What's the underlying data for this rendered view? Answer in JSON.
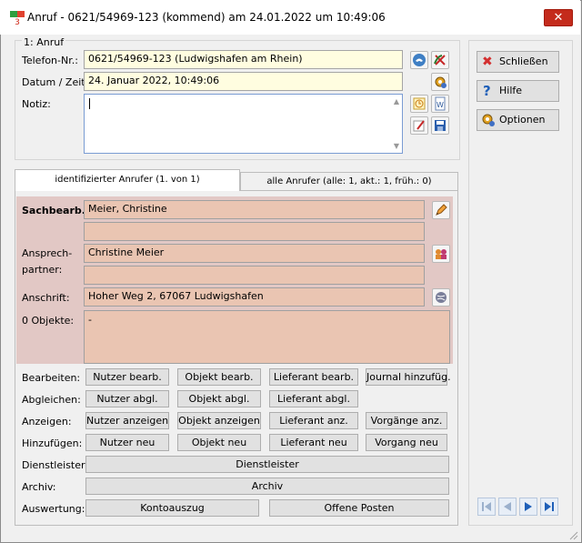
{
  "window": {
    "title": "Anruf - 0621/54969-123 (kommend) am 24.01.2022 um 10:49:06",
    "close_glyph": "✕"
  },
  "call": {
    "group_label": "1: Anruf",
    "phone_label": "Telefon-Nr.:",
    "phone_value": "0621/54969-123  (Ludwigshafen am Rhein)",
    "datetime_label": "Datum / Zeit:",
    "datetime_value": "24. Januar 2022,  10:49:06",
    "note_label": "Notiz:",
    "note_value": ""
  },
  "tabs": [
    {
      "label": "identifizierter Anrufer  (1. von 1)"
    },
    {
      "label": "alle Anrufer (alle: 1,  akt.: 1,  früh.: 0)"
    }
  ],
  "caller": {
    "clerk_label": "Sachbearb.:",
    "clerk_value": "Meier, Christine",
    "clerk_value2": "",
    "contact_label": "Ansprech-partner:",
    "contact_value": "Christine Meier",
    "contact_value2": "",
    "address_label": "Anschrift:",
    "address_value": "Hoher Weg 2, 67067 Ludwigshafen",
    "objects_label": "0 Objekte:",
    "objects_value": "-"
  },
  "actions": [
    {
      "label": "Bearbeiten:",
      "buttons": [
        "Nutzer bearb.",
        "Objekt bearb.",
        "Lieferant bearb.",
        "Journal hinzufüg."
      ]
    },
    {
      "label": "Abgleichen:",
      "buttons": [
        "Nutzer abgl.",
        "Objekt abgl.",
        "Lieferant abgl."
      ]
    },
    {
      "label": "Anzeigen:",
      "buttons": [
        "Nutzer anzeigen",
        "Objekt anzeigen",
        "Lieferant anz.",
        "Vorgänge anz."
      ]
    },
    {
      "label": "Hinzufügen:",
      "buttons": [
        "Nutzer neu",
        "Objekt neu",
        "Lieferant neu",
        "Vorgang neu"
      ]
    },
    {
      "label": "Dienstleister:",
      "buttons": [
        "Dienstleister"
      ]
    },
    {
      "label": "Archiv:",
      "buttons": [
        "Archiv"
      ]
    },
    {
      "label": "Auswertung:",
      "buttons": [
        "Kontoauszug",
        "Offene Posten"
      ]
    }
  ],
  "sidebar": {
    "close_label": "Schließen",
    "help_label": "Hilfe",
    "options_label": "Optionen"
  },
  "colors": {
    "accent_pink": "#e2c8c5",
    "field_yellow": "#fffde0",
    "close_red": "#c42b1c"
  }
}
